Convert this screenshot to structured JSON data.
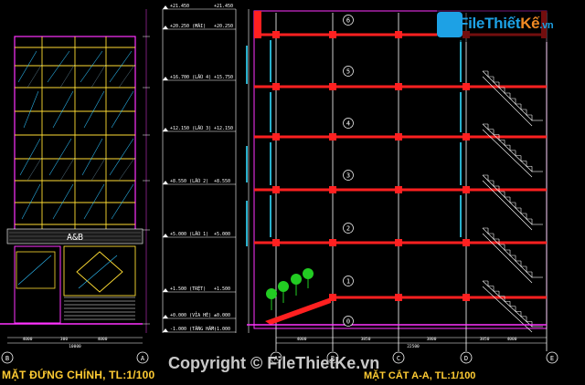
{
  "titles": {
    "left": "MẶT ĐỨNG CHÍNH, TL:1/100",
    "right": "MẶT CẮT A-A, TL:1/100"
  },
  "watermark": {
    "prefix": "File",
    "middle": "Thiết",
    "suffix": "Kế",
    "domain": ".vn",
    "copyright": "Copyright © FileThietKe.vn"
  },
  "elevation_levels": [
    {
      "label": "+21.450",
      "value": "+21.450"
    },
    {
      "label": "+20.250 (MÁI)",
      "value": "+20.250"
    },
    {
      "label": "+16.700 (LẦU 4)",
      "value": "+15.750"
    },
    {
      "label": "+12.150 (LẦU 3)",
      "value": "+12.150"
    },
    {
      "label": "+8.550 (LẦU 2)",
      "value": "+8.550"
    },
    {
      "label": "+5.000 (LẦU 1)",
      "value": "+5.000"
    },
    {
      "label": "+1.500 (TRỆT)",
      "value": "+1.500"
    },
    {
      "label": "+0.000 (VỈA HÈ)",
      "value": "±0.000"
    },
    {
      "label": "-1.000 (TẦNG HẦM)",
      "value": "-1.000"
    }
  ],
  "section_levels": [
    "+21.450",
    "+20.250",
    "+16.700",
    "+12.150",
    "+8.550",
    "+5.000",
    "+1.500",
    "±0.000",
    "-1.000"
  ],
  "axis_labels_left": [
    "B",
    "A"
  ],
  "axis_labels_right": [
    "A",
    "B",
    "C",
    "D",
    "E"
  ],
  "section_bubbles": [
    "6",
    "5",
    "4",
    "3",
    "2",
    "1",
    "0"
  ],
  "sign_text": "A&B",
  "dims_left": [
    "4000",
    "300",
    "4000",
    "10000"
  ],
  "dims_right": [
    "4000",
    "3850",
    "3800",
    "3850",
    "4000",
    "22500"
  ],
  "colors": {
    "bg": "#000000",
    "grid": "#ffffff",
    "beam": "#ff2020",
    "glass": "#ffdd33",
    "facade": "#ff33ff",
    "tree": "#22cc22",
    "accent": "#33ddff"
  }
}
